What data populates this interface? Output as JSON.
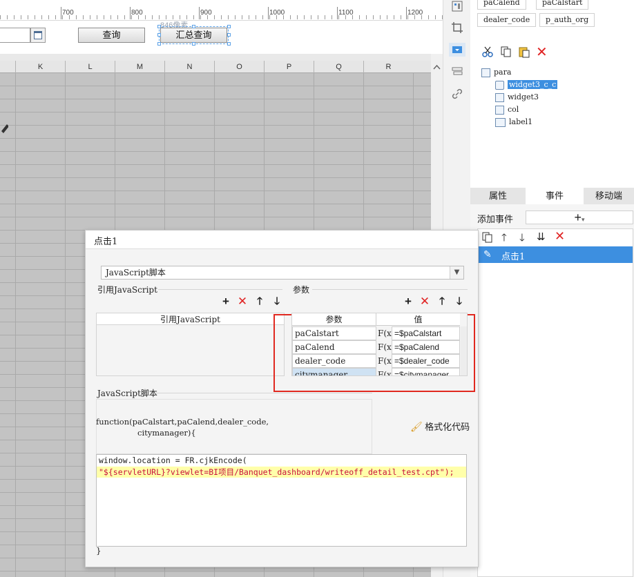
{
  "ruler": {
    "ticks": [
      "700",
      "800",
      "900",
      "1000",
      "1100",
      "1200"
    ],
    "overlay_label": "846像素"
  },
  "parambar": {
    "query_label": "查询",
    "summary_query_label": "汇总查询"
  },
  "grid": {
    "columns": [
      "K",
      "L",
      "M",
      "N",
      "O",
      "P",
      "Q",
      "R"
    ]
  },
  "right_panel": {
    "param_chips": [
      "paCalend",
      "paCalstart",
      "dealer_code",
      "p_auth_org"
    ],
    "tree": {
      "root": "para",
      "items": [
        "widget3_c_c",
        "widget3",
        "col",
        "label1"
      ],
      "selected": "widget3_c_c"
    },
    "tabs": [
      "属性",
      "事件",
      "移动端"
    ],
    "active_tab": "事件",
    "add_event_label": "添加事件",
    "events": [
      "点击1"
    ]
  },
  "dialog": {
    "title": "点击1",
    "type_select": "JavaScript脚本",
    "ref_js_title": "引用JavaScript",
    "ref_js_header": "引用JavaScript",
    "params_title": "参数",
    "params_table": {
      "headers": [
        "参数",
        "值"
      ],
      "rows": [
        {
          "name": "paCalstart",
          "value": "=$paCalstart"
        },
        {
          "name": "paCalend",
          "value": "=$paCalend"
        },
        {
          "name": "dealer_code",
          "value": "=$dealer_code"
        },
        {
          "name": "citymanager",
          "value": "=$citymanager"
        }
      ]
    },
    "fx_label": "F(x)",
    "js_script_title": "JavaScript脚本",
    "function_signature_line1": "function(paCalstart,paCalend,dealer_code,",
    "function_signature_line2": "citymanager){",
    "format_code_label": "格式化代码",
    "code_line1": "window.location = FR.cjkEncode(",
    "code_line2": "\"${servletURL}?viewlet=BI项目/Banquet_dashboard/writeoff_detail_test.cpt\");",
    "closing_brace": "}"
  },
  "colors": {
    "accent": "#3d8fe0",
    "highlight_red": "#e0281f",
    "grid_bg": "#c3c3c3",
    "code_highlight": "#ffffaa"
  }
}
